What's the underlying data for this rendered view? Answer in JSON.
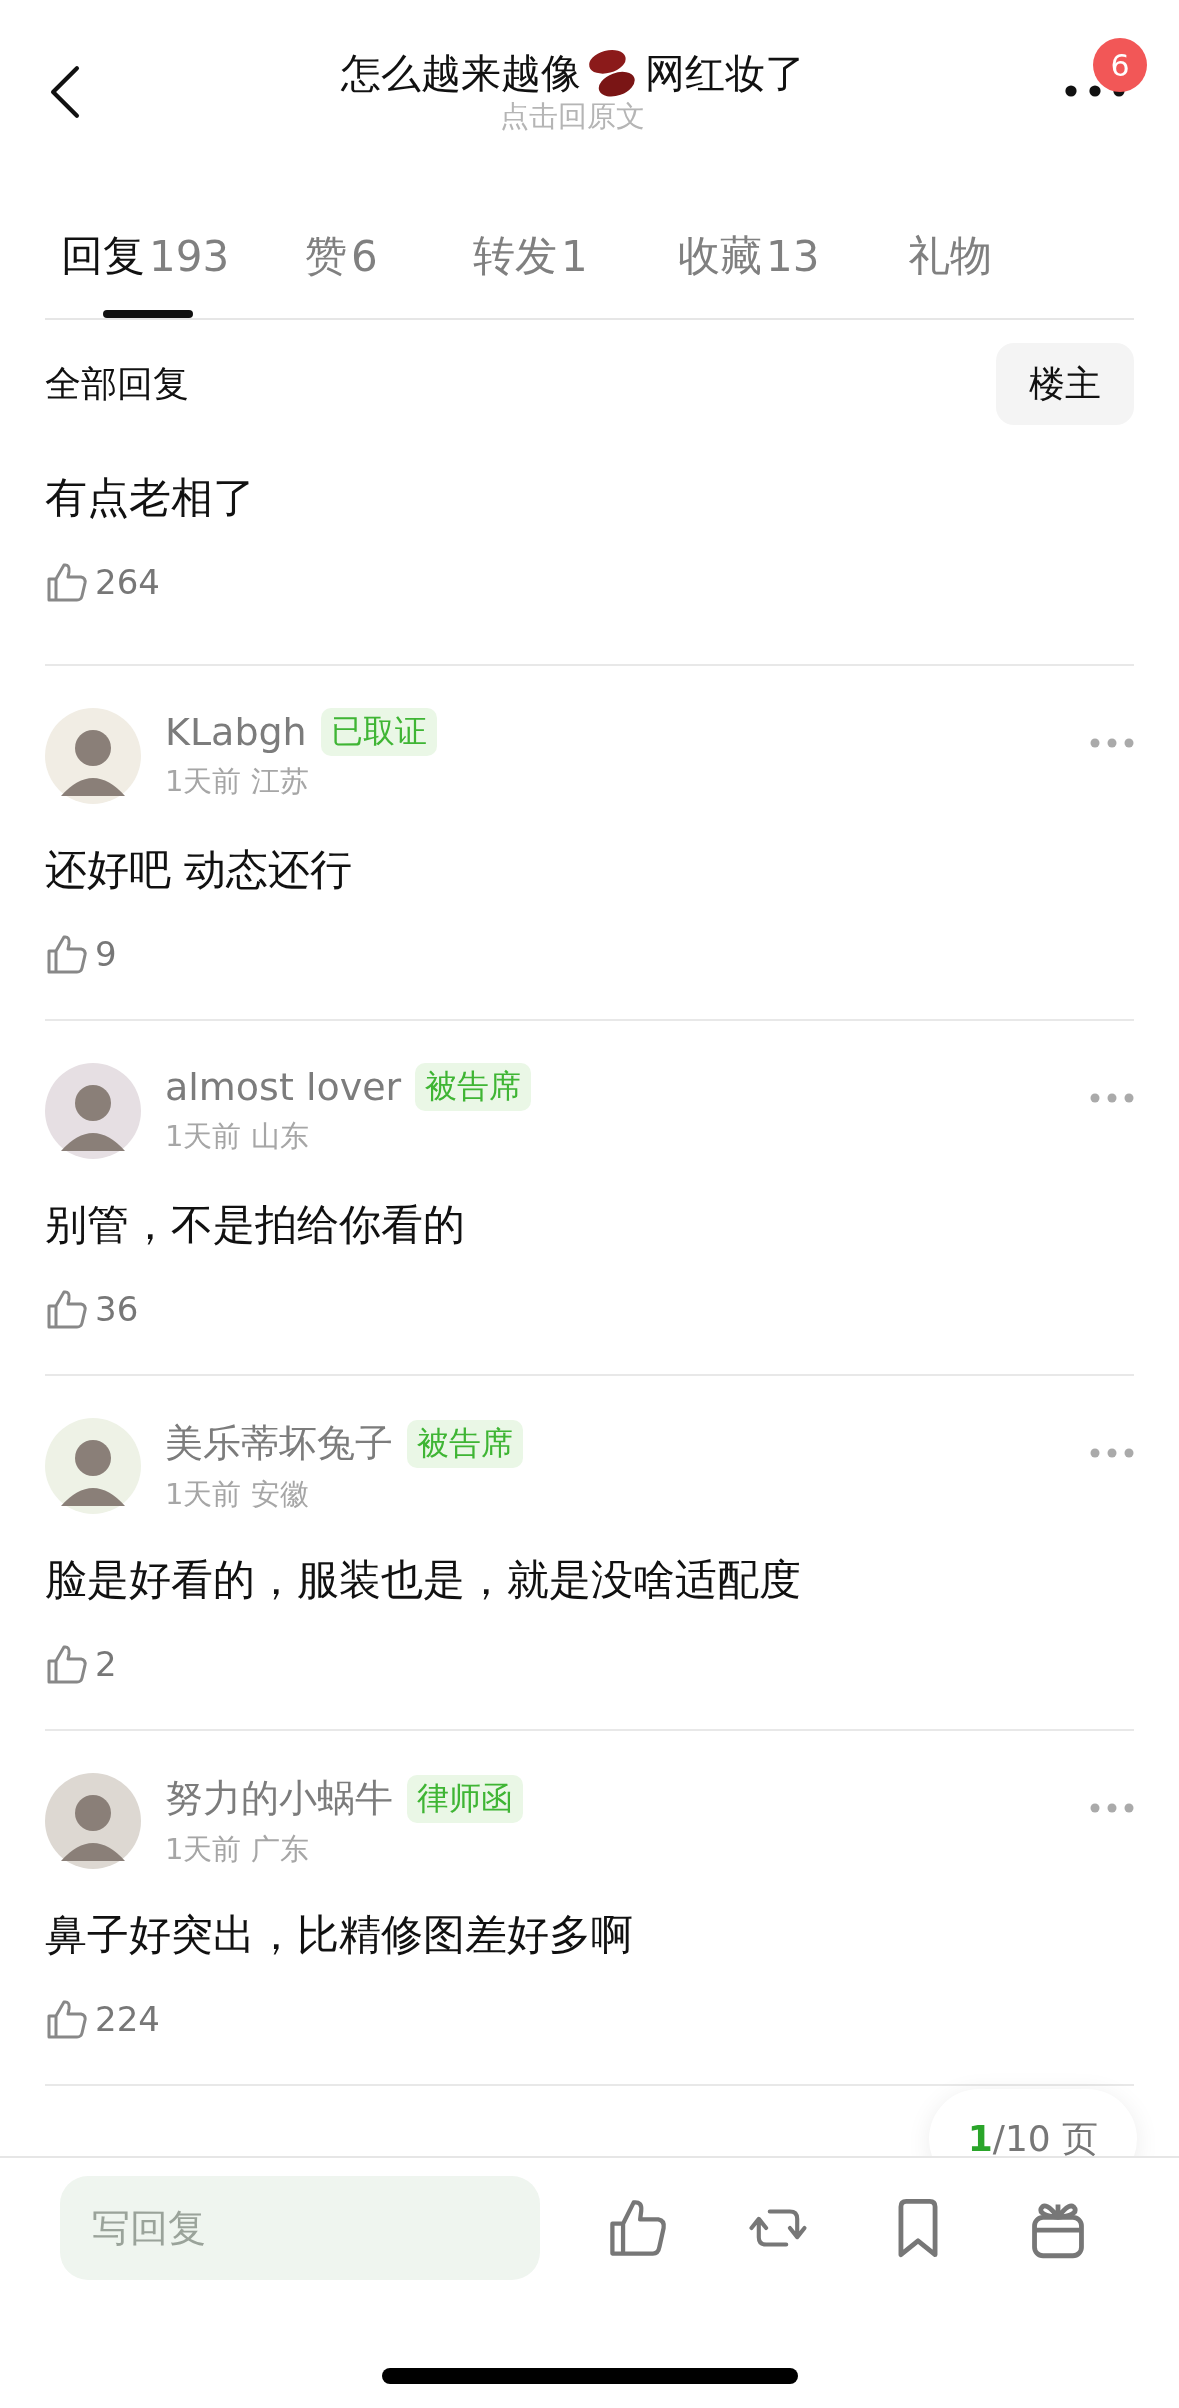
{
  "header": {
    "title_parts": [
      "怎么越来越像",
      "网红妆了"
    ],
    "subtitle": "点击回原文",
    "notification_count": "6"
  },
  "tabs": [
    {
      "label": "回复",
      "count": "193",
      "selected": true
    },
    {
      "label": "赞",
      "count": "6",
      "selected": false
    },
    {
      "label": "转发",
      "count": "1",
      "selected": false
    },
    {
      "label": "收藏",
      "count": "13",
      "selected": false
    },
    {
      "label": "礼物",
      "selected": false
    }
  ],
  "filter": {
    "label": "全部回复",
    "button": "楼主"
  },
  "comments": [
    {
      "kind": "continued",
      "text": "有点老相了",
      "likes": "264"
    },
    {
      "kind": "full",
      "name": "KLabgh",
      "badge": "已取证",
      "time": "1天前",
      "region": "江苏",
      "text": "还好吧 动态还行",
      "likes": "9"
    },
    {
      "kind": "full",
      "name": "almost lover",
      "badge": "被告席",
      "time": "1天前",
      "region": "山东",
      "text": "别管，不是拍给你看的",
      "likes": "36"
    },
    {
      "kind": "full",
      "name": "美乐蒂坏兔子",
      "badge": "被告席",
      "time": "1天前",
      "region": "安徽",
      "text": "脸是好看的，服装也是，就是没啥适配度",
      "likes": "2"
    },
    {
      "kind": "full",
      "name": "努力的小蜗牛",
      "badge": "律师函",
      "time": "1天前",
      "region": "广东",
      "text": "鼻子好突出，比精修图差好多啊",
      "likes": "224"
    }
  ],
  "pager": {
    "current": "1",
    "total": "/10 页"
  },
  "reply_bar": {
    "placeholder": "写回复"
  }
}
